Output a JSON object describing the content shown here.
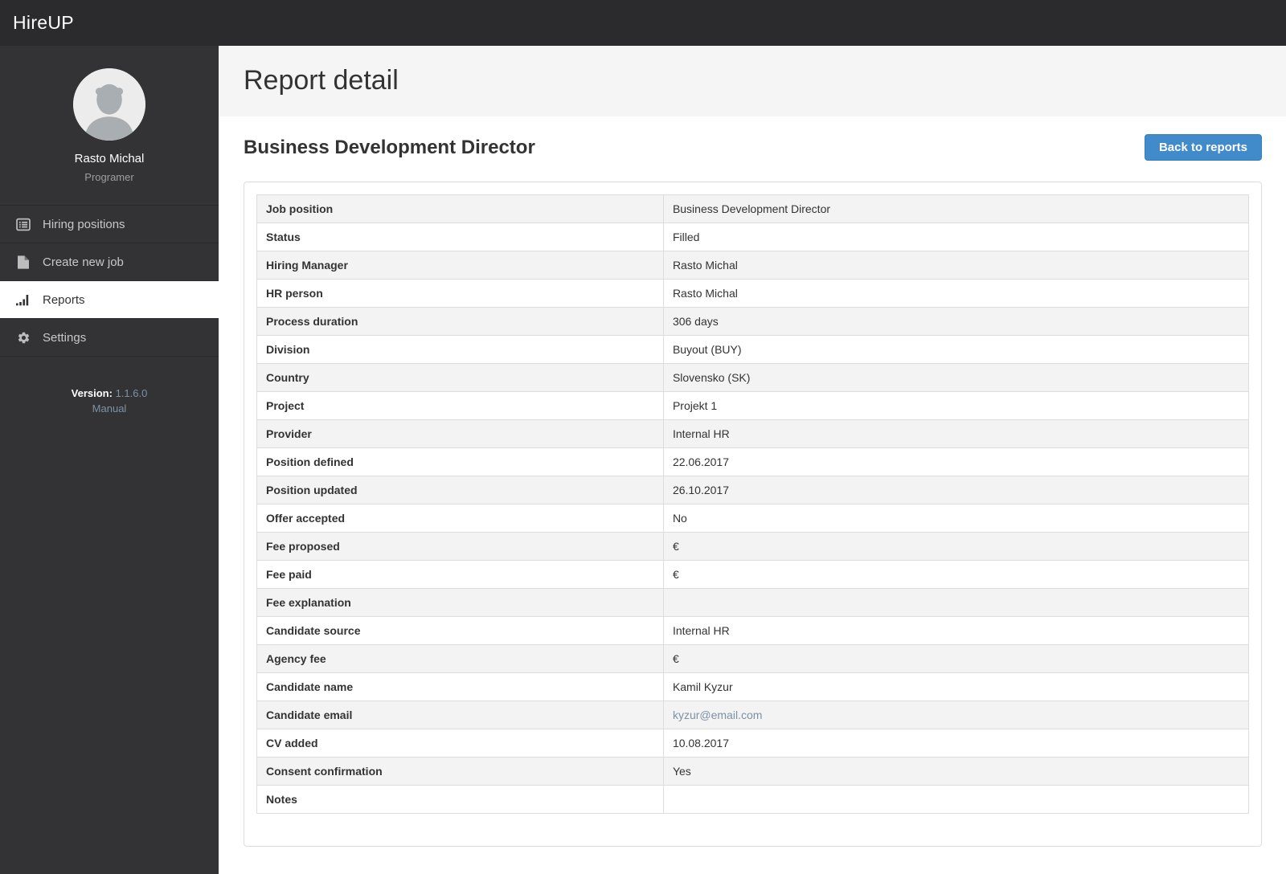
{
  "app": {
    "brand": "HireUP"
  },
  "colors": {
    "topbar_bg": "#2b2b2d",
    "sidebar_bg": "#333336",
    "accent": "#428bca",
    "accent_border": "#357ebd",
    "muted_link": "#7d92a6",
    "table_stripe": "#f3f3f3",
    "table_border": "#dddddd"
  },
  "sidebar": {
    "user": {
      "name": "Rasto Michal",
      "role": "Programer"
    },
    "menu": [
      {
        "label": "Hiring positions",
        "icon": "list-icon",
        "active": false
      },
      {
        "label": "Create new job",
        "icon": "file-icon",
        "active": false
      },
      {
        "label": "Reports",
        "icon": "bar-chart-icon",
        "active": true
      },
      {
        "label": "Settings",
        "icon": "gear-icon",
        "active": false
      }
    ],
    "version_label": "Version:",
    "version_value": "1.1.6.0",
    "manual_link": "Manual"
  },
  "header": {
    "page_title": "Report detail"
  },
  "report": {
    "title": "Business Development Director",
    "back_button": "Back to reports",
    "rows": [
      {
        "label": "Job position",
        "value": "Business Development Director",
        "type": "text"
      },
      {
        "label": "Status",
        "value": "Filled",
        "type": "text"
      },
      {
        "label": "Hiring Manager",
        "value": "Rasto Michal",
        "type": "text"
      },
      {
        "label": "HR person",
        "value": "Rasto Michal",
        "type": "text"
      },
      {
        "label": "Process duration",
        "value": "306 days",
        "type": "text"
      },
      {
        "label": "Division",
        "value": "Buyout (BUY)",
        "type": "text"
      },
      {
        "label": "Country",
        "value": "Slovensko (SK)",
        "type": "text"
      },
      {
        "label": "Project",
        "value": "Projekt 1",
        "type": "text"
      },
      {
        "label": "Provider",
        "value": "Internal HR",
        "type": "text"
      },
      {
        "label": "Position defined",
        "value": "22.06.2017",
        "type": "text"
      },
      {
        "label": "Position updated",
        "value": "26.10.2017",
        "type": "text"
      },
      {
        "label": "Offer accepted",
        "value": "No",
        "type": "text"
      },
      {
        "label": "Fee proposed",
        "value": "€",
        "type": "text"
      },
      {
        "label": "Fee paid",
        "value": "€",
        "type": "text"
      },
      {
        "label": "Fee explanation",
        "value": "",
        "type": "text"
      },
      {
        "label": "Candidate source",
        "value": "Internal HR",
        "type": "text"
      },
      {
        "label": "Agency fee",
        "value": "€",
        "type": "text"
      },
      {
        "label": "Candidate name",
        "value": "Kamil Kyzur",
        "type": "text"
      },
      {
        "label": "Candidate email",
        "value": "kyzur@email.com",
        "type": "link"
      },
      {
        "label": "CV added",
        "value": "10.08.2017",
        "type": "text"
      },
      {
        "label": "Consent confirmation",
        "value": "Yes",
        "type": "text"
      },
      {
        "label": "Notes",
        "value": "",
        "type": "text"
      }
    ]
  }
}
